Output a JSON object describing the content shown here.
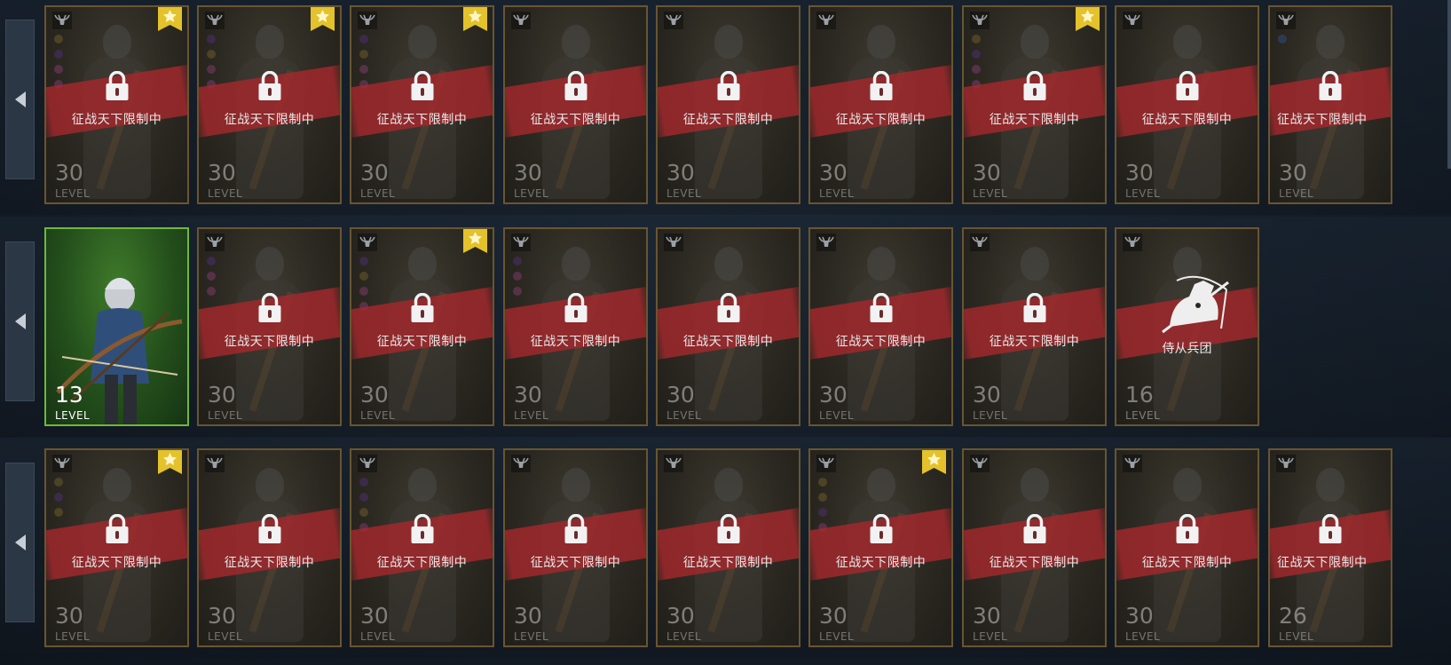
{
  "restrict_text": "征战天下限制中",
  "level_label": "LEVEL",
  "colors": {
    "border_locked": "#6a5530",
    "border_unlocked": "#6fb83c",
    "stripe": "#a8262c",
    "banner": "#e3c22b"
  },
  "rows": [
    {
      "cards": [
        {
          "level": "30",
          "banner": true,
          "locked": true,
          "dots": [
            "#6a5b2a",
            "#4a2f6b",
            "#7a3a68",
            "#7a3a68"
          ]
        },
        {
          "level": "30",
          "banner": true,
          "locked": true,
          "dots": [
            "#4a2f6b",
            "#6a5b2a",
            "#7a3a68",
            "#7a3a68"
          ]
        },
        {
          "level": "30",
          "banner": true,
          "locked": true,
          "dots": [
            "#4a2f6b",
            "#6a5b2a",
            "#7a3a68",
            "#7a3a68"
          ]
        },
        {
          "level": "30",
          "banner": false,
          "locked": true,
          "dots": []
        },
        {
          "level": "30",
          "banner": false,
          "locked": true,
          "dots": []
        },
        {
          "level": "30",
          "banner": false,
          "locked": true,
          "dots": []
        },
        {
          "level": "30",
          "banner": true,
          "locked": true,
          "dots": [
            "#6a5b2a",
            "#4a2f6b",
            "#7a3a68",
            "#7a3a68"
          ]
        },
        {
          "level": "30",
          "banner": false,
          "locked": true,
          "dots": []
        },
        {
          "level": "30",
          "banner": false,
          "locked": true,
          "dots": [
            "#2f4a7a"
          ],
          "partial": true
        }
      ]
    },
    {
      "cards": [
        {
          "level": "13",
          "banner": false,
          "locked": false,
          "unlocked_unit": "archer",
          "dots": []
        },
        {
          "level": "30",
          "banner": false,
          "locked": true,
          "dots": [
            "#4a2f6b",
            "#7a3a68",
            "#7a3a68"
          ]
        },
        {
          "level": "30",
          "banner": true,
          "locked": true,
          "dots": [
            "#4a2f6b",
            "#6a5b2a",
            "#7a3a68",
            "#7a3a68"
          ]
        },
        {
          "level": "30",
          "banner": false,
          "locked": true,
          "dots": [
            "#4a2f6b",
            "#7a3a68",
            "#7a3a68"
          ]
        },
        {
          "level": "30",
          "banner": false,
          "locked": true,
          "dots": []
        },
        {
          "level": "30",
          "banner": false,
          "locked": true,
          "dots": []
        },
        {
          "level": "30",
          "banner": false,
          "locked": true,
          "dots": []
        },
        {
          "level": "16",
          "banner": false,
          "locked": false,
          "special_label": "侍从兵团",
          "dots": []
        }
      ]
    },
    {
      "cards": [
        {
          "level": "30",
          "banner": true,
          "locked": true,
          "dots": [
            "#6a5b2a",
            "#4a2f6b",
            "#6a5b2a"
          ]
        },
        {
          "level": "30",
          "banner": false,
          "locked": true,
          "dots": []
        },
        {
          "level": "30",
          "banner": false,
          "locked": true,
          "dots": [
            "#4a2f6b",
            "#4a2f6b",
            "#6a5b2a",
            "#7a3a68"
          ]
        },
        {
          "level": "30",
          "banner": false,
          "locked": true,
          "dots": []
        },
        {
          "level": "30",
          "banner": false,
          "locked": true,
          "dots": []
        },
        {
          "level": "30",
          "banner": true,
          "locked": true,
          "dots": [
            "#6a5b2a",
            "#6a5b2a",
            "#4a2f6b",
            "#7a3a68"
          ]
        },
        {
          "level": "30",
          "banner": false,
          "locked": true,
          "dots": []
        },
        {
          "level": "30",
          "banner": false,
          "locked": true,
          "dots": []
        },
        {
          "level": "26",
          "banner": false,
          "locked": true,
          "dots": [],
          "partial": true
        }
      ]
    }
  ],
  "icons": {
    "side_arrow": "left-arrow-icon",
    "lock": "lock-icon",
    "banner": "star-banner-icon",
    "unit_type": "bull-emblem-icon",
    "retinue": "knight-horse-icon"
  }
}
